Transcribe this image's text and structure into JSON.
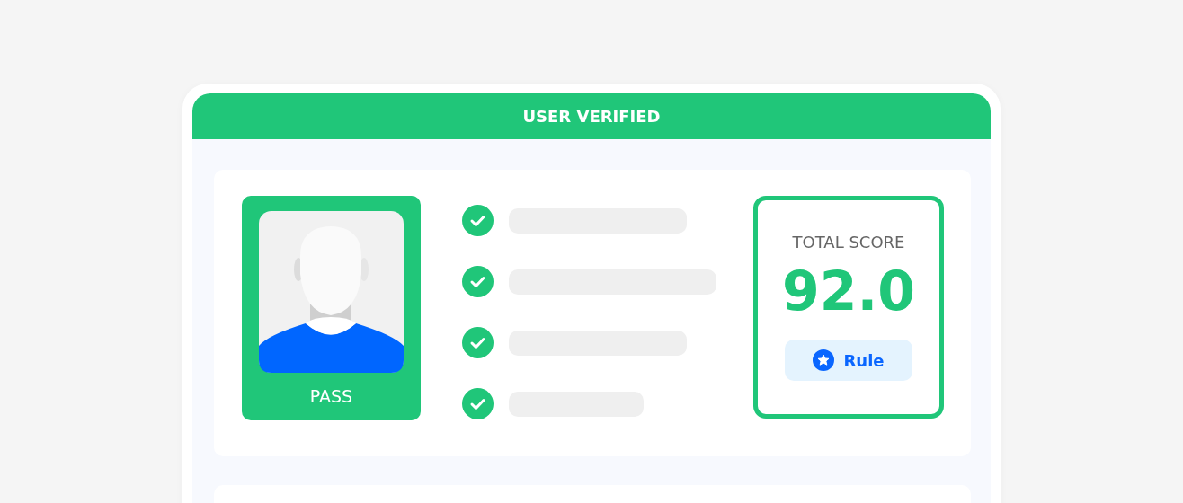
{
  "header": {
    "title": "USER VERIFIED"
  },
  "id_card": {
    "status": "PASS"
  },
  "checks": [
    {
      "checked": true
    },
    {
      "checked": true
    },
    {
      "checked": true
    },
    {
      "checked": true
    }
  ],
  "score": {
    "label": "TOTAL SCORE",
    "value": "92.0",
    "badge": "Rule"
  }
}
